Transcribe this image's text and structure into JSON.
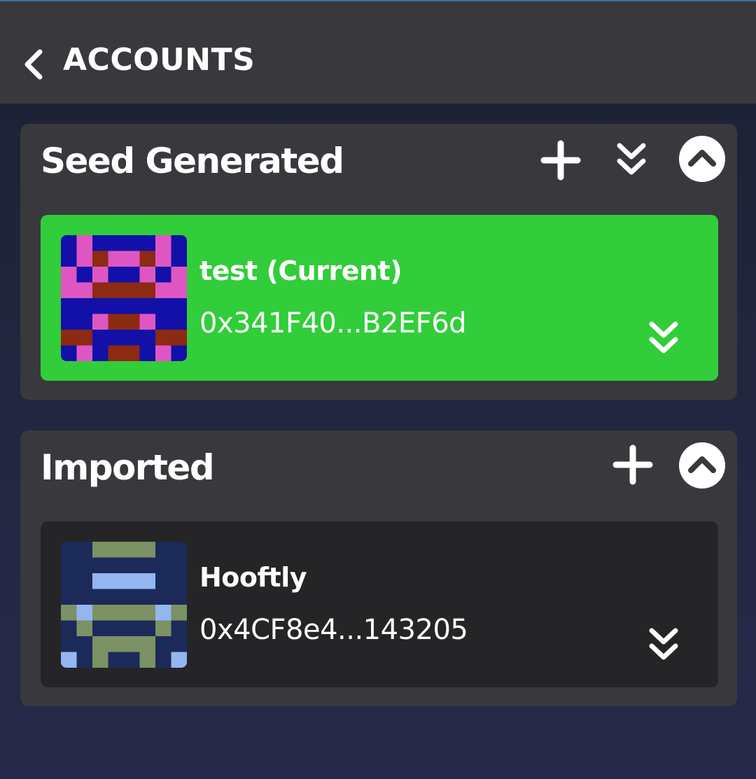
{
  "header": {
    "title": "ACCOUNTS",
    "back_icon": "chevron-left-icon"
  },
  "groups": [
    {
      "title": "Seed Generated",
      "actions": [
        "plus-icon",
        "double-chevron-down-icon",
        "chevron-up-circle-icon"
      ],
      "accounts": [
        {
          "name": "test (Current)",
          "address": "0x341F40...B2EF6d",
          "current": true,
          "background": "#32cd3a"
        }
      ]
    },
    {
      "title": "Imported",
      "actions": [
        "plus-icon",
        "chevron-up-circle-icon"
      ],
      "accounts": [
        {
          "name": "Hooftly",
          "address": "0x4CF8e4...143205",
          "current": false,
          "background": "#252527"
        }
      ]
    }
  ],
  "colors": {
    "header_bg": "#39393d",
    "group_bg": "#39393d",
    "current_account": "#32cd3a",
    "account_bg": "#252527"
  }
}
